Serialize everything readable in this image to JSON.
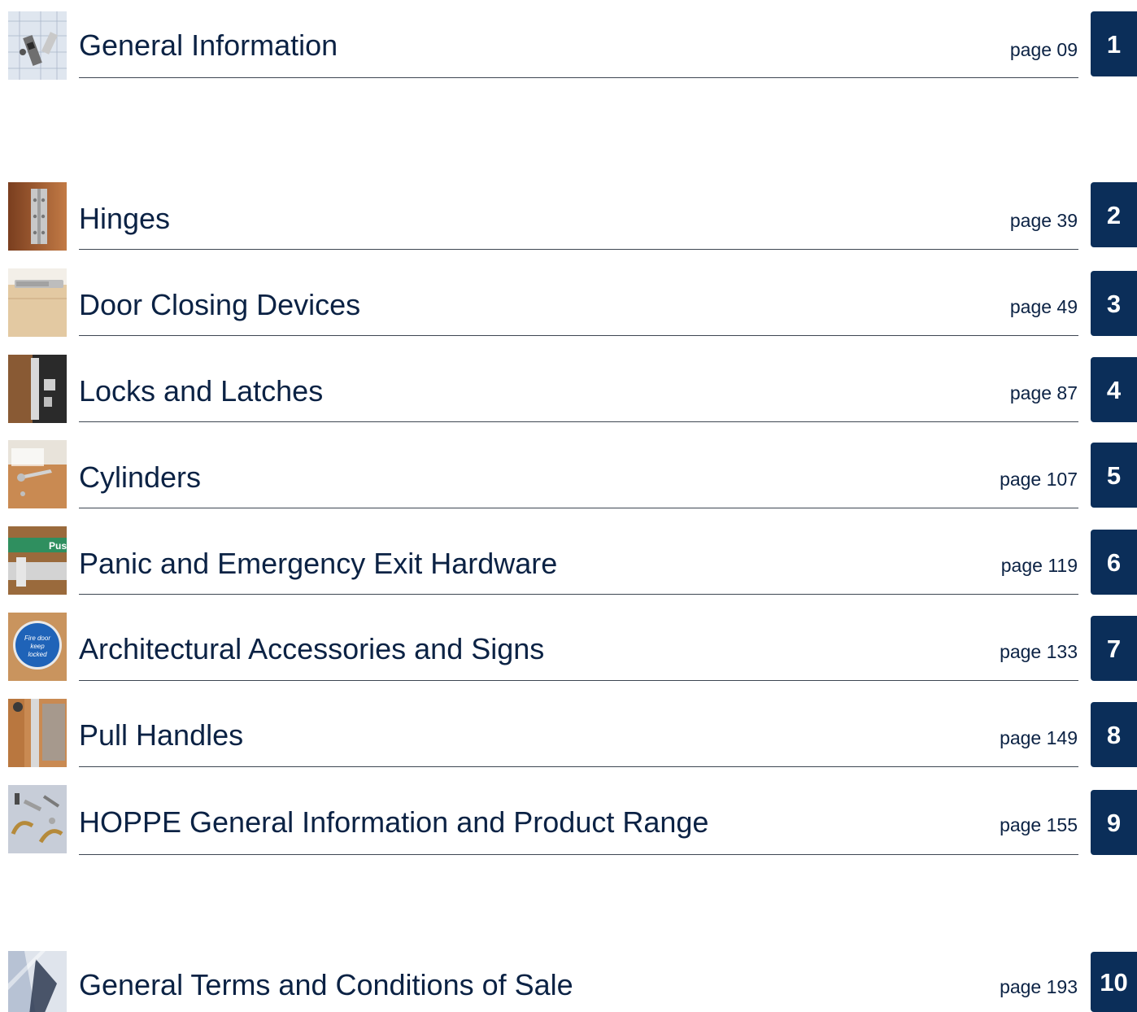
{
  "sections": [
    {
      "title": "General Information",
      "page": "page 09",
      "number": "1",
      "thumbnail": "plans-and-hardware-photo"
    },
    {
      "title": "Hinges",
      "page": "page 39",
      "number": "2",
      "thumbnail": "hinge-photo"
    },
    {
      "title": "Door Closing Devices",
      "page": "page 49",
      "number": "3",
      "thumbnail": "door-closer-photo"
    },
    {
      "title": "Locks and Latches",
      "page": "page 87",
      "number": "4",
      "thumbnail": "lock-photo"
    },
    {
      "title": "Cylinders",
      "page": "page 107",
      "number": "5",
      "thumbnail": "door-handle-photo"
    },
    {
      "title": "Panic and Emergency Exit Hardware",
      "page": "page 119",
      "number": "6",
      "thumbnail": "push-bar-photo"
    },
    {
      "title": "Architectural Accessories and Signs",
      "page": "page 133",
      "number": "7",
      "thumbnail": "fire-door-sign-photo"
    },
    {
      "title": "Pull Handles",
      "page": "page 149",
      "number": "8",
      "thumbnail": "pull-handle-photo"
    },
    {
      "title": "HOPPE General Information and Product Range",
      "page": "page 155",
      "number": "9",
      "thumbnail": "handles-assortment-photo"
    },
    {
      "title": "General Terms and Conditions of Sale",
      "page": "page 193",
      "number": "10",
      "thumbnail": "folder-photo"
    }
  ],
  "signs": {
    "push": "Pus",
    "fire_door": "Fire door",
    "keep": "keep",
    "locked": "locked"
  },
  "colors": {
    "text": "#0b2244",
    "tab": "#0b2e59",
    "rule": "#3d4652"
  }
}
